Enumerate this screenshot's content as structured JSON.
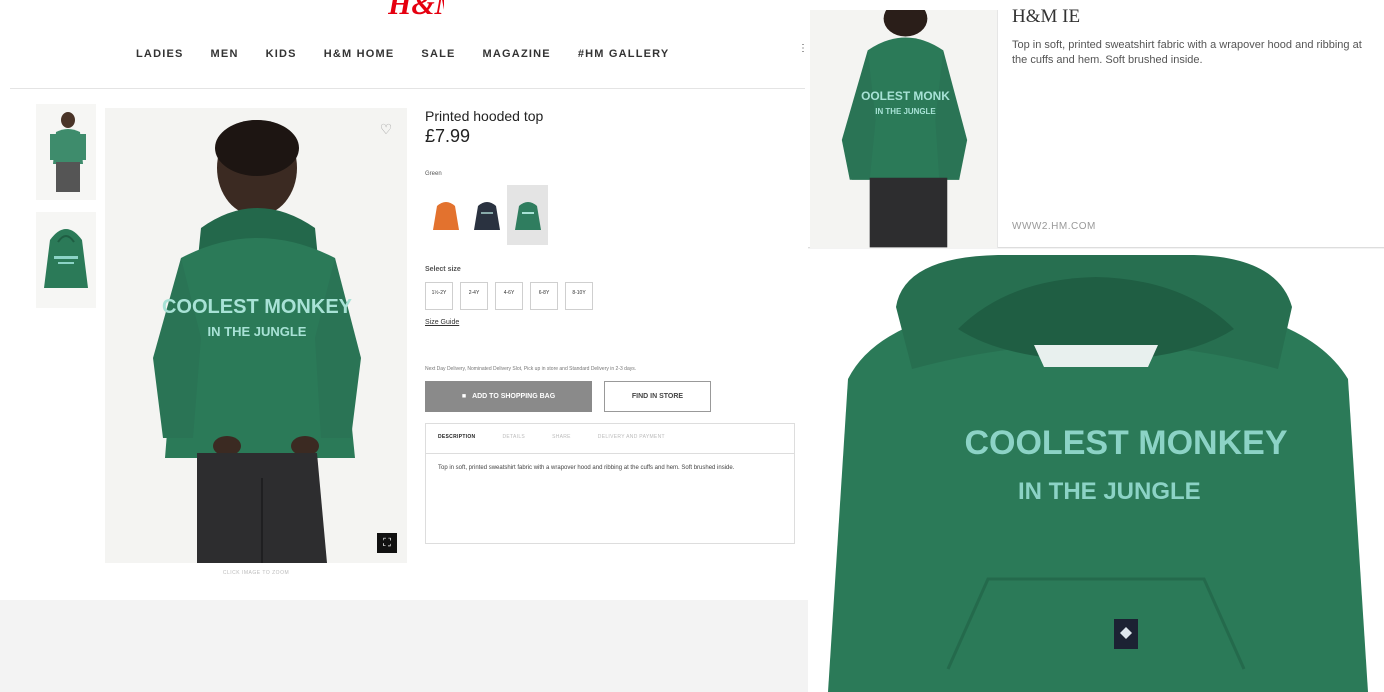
{
  "store": {
    "logo": "H&M",
    "nav": [
      "LADIES",
      "MEN",
      "KIDS",
      "H&M HOME",
      "SALE",
      "MAGAZINE",
      "#HM GALLERY"
    ],
    "nav_more": "⋮"
  },
  "product": {
    "title": "Printed hooded top",
    "price": "£7.99",
    "color_label": "Green",
    "swatch_colors": [
      "#e3722e",
      "#2a3240",
      "#2f7d5f"
    ],
    "size_label": "Select size",
    "sizes": [
      "1½-2Y",
      "2-4Y",
      "4-6Y",
      "6-8Y",
      "8-10Y"
    ],
    "size_guide": "Size Guide",
    "delivery_note": "Next Day Delivery, Nominated Delivery Slot, Pick up in store and Standard Delivery in 2-3 days.",
    "add_to_bag": "ADD TO SHOPPING BAG",
    "find_in_store": "FIND IN STORE",
    "tabs": [
      "DESCRIPTION",
      "DETAILS",
      "SHARE",
      "DELIVERY AND PAYMENT"
    ],
    "description": "Top in soft, printed sweatshirt fabric with a wrapover hood and ribbing at the cuffs and hem. Soft brushed inside.",
    "zoom_hint": "CLICK IMAGE TO ZOOM",
    "hoodie_print_line1": "COOLEST MONKEY",
    "hoodie_print_line2": "IN THE JUNGLE",
    "hoodie_color": "#2b7a58"
  },
  "share_card": {
    "title": "H&M IE",
    "description": "Top in soft, printed sweatshirt fabric with a wrapover hood and ribbing at the cuffs and hem. Soft brushed inside.",
    "domain": "WWW2.HM.COM"
  },
  "icons": {
    "wishlist": "heart-icon",
    "expand": "expand-icon",
    "bag": "bag-icon"
  }
}
